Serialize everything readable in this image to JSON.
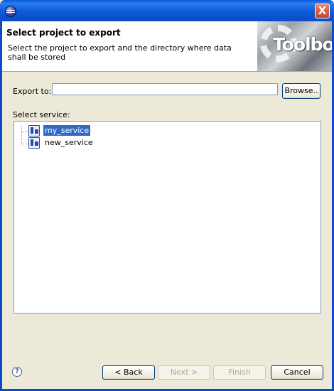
{
  "window": {
    "title": "",
    "close_glyph": "X"
  },
  "banner": {
    "title": "Select project to export",
    "description": "Select the project to export and the directory where data shall be stored",
    "image_text": "Toolbox"
  },
  "export": {
    "label": "Export to:",
    "value": "",
    "browse_label": "Browse.."
  },
  "service": {
    "label": "Select service:",
    "items": [
      {
        "name": "my_service",
        "selected": true
      },
      {
        "name": "new_service",
        "selected": false
      }
    ]
  },
  "footer": {
    "help_glyph": "?",
    "back_label": "< Back",
    "next_label": "Next >",
    "finish_label": "Finish",
    "cancel_label": "Cancel"
  },
  "colors": {
    "titlebar": "#0a59dc",
    "selection": "#316ac5",
    "window_bg": "#ece9d8"
  }
}
